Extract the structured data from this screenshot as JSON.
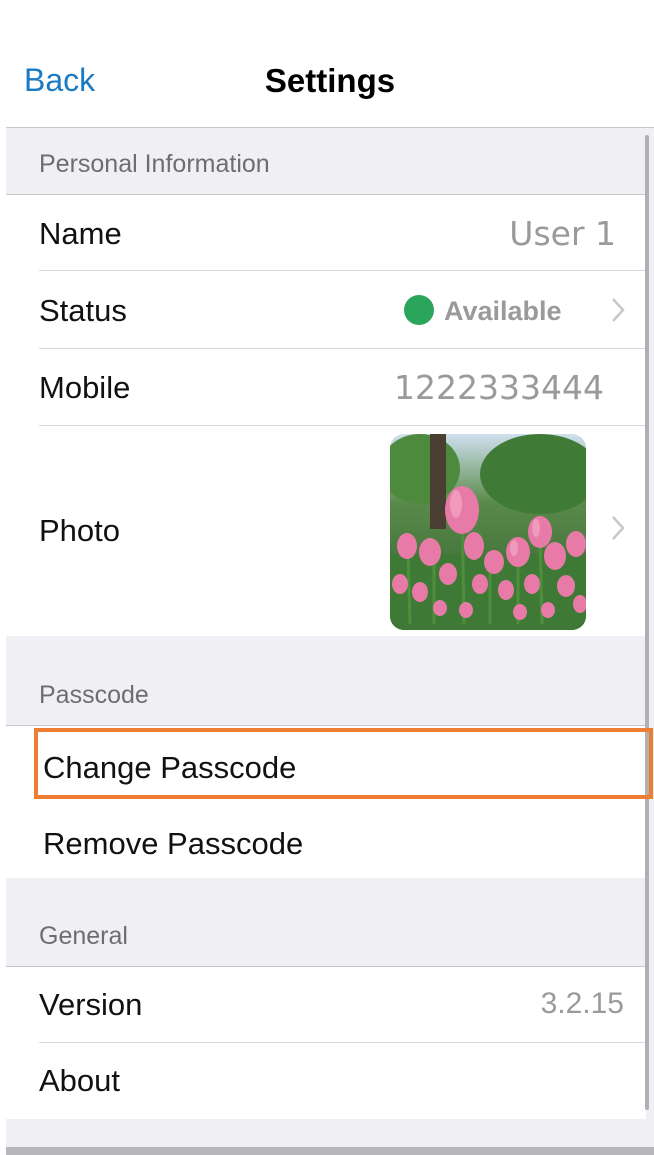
{
  "nav": {
    "back_label": "Back",
    "title": "Settings"
  },
  "sections": {
    "personal": {
      "header": "Personal Information",
      "name_label": "Name",
      "name_value": "User 1",
      "status_label": "Status",
      "status_value": "Available",
      "status_color": "#2aa55b",
      "mobile_label": "Mobile",
      "mobile_value": "1222333444",
      "photo_label": "Photo",
      "photo_icon": "tulip-photo"
    },
    "passcode": {
      "header": "Passcode",
      "change_label": "Change Passcode",
      "remove_label": "Remove Passcode",
      "highlight_color": "#ee7d31"
    },
    "general": {
      "header": "General",
      "version_label": "Version",
      "version_value": "3.2.15",
      "about_label": "About"
    }
  },
  "colors": {
    "accent": "#1a7bc4",
    "group_bg": "#f0eff4",
    "chevron": "#c7c7cc"
  }
}
